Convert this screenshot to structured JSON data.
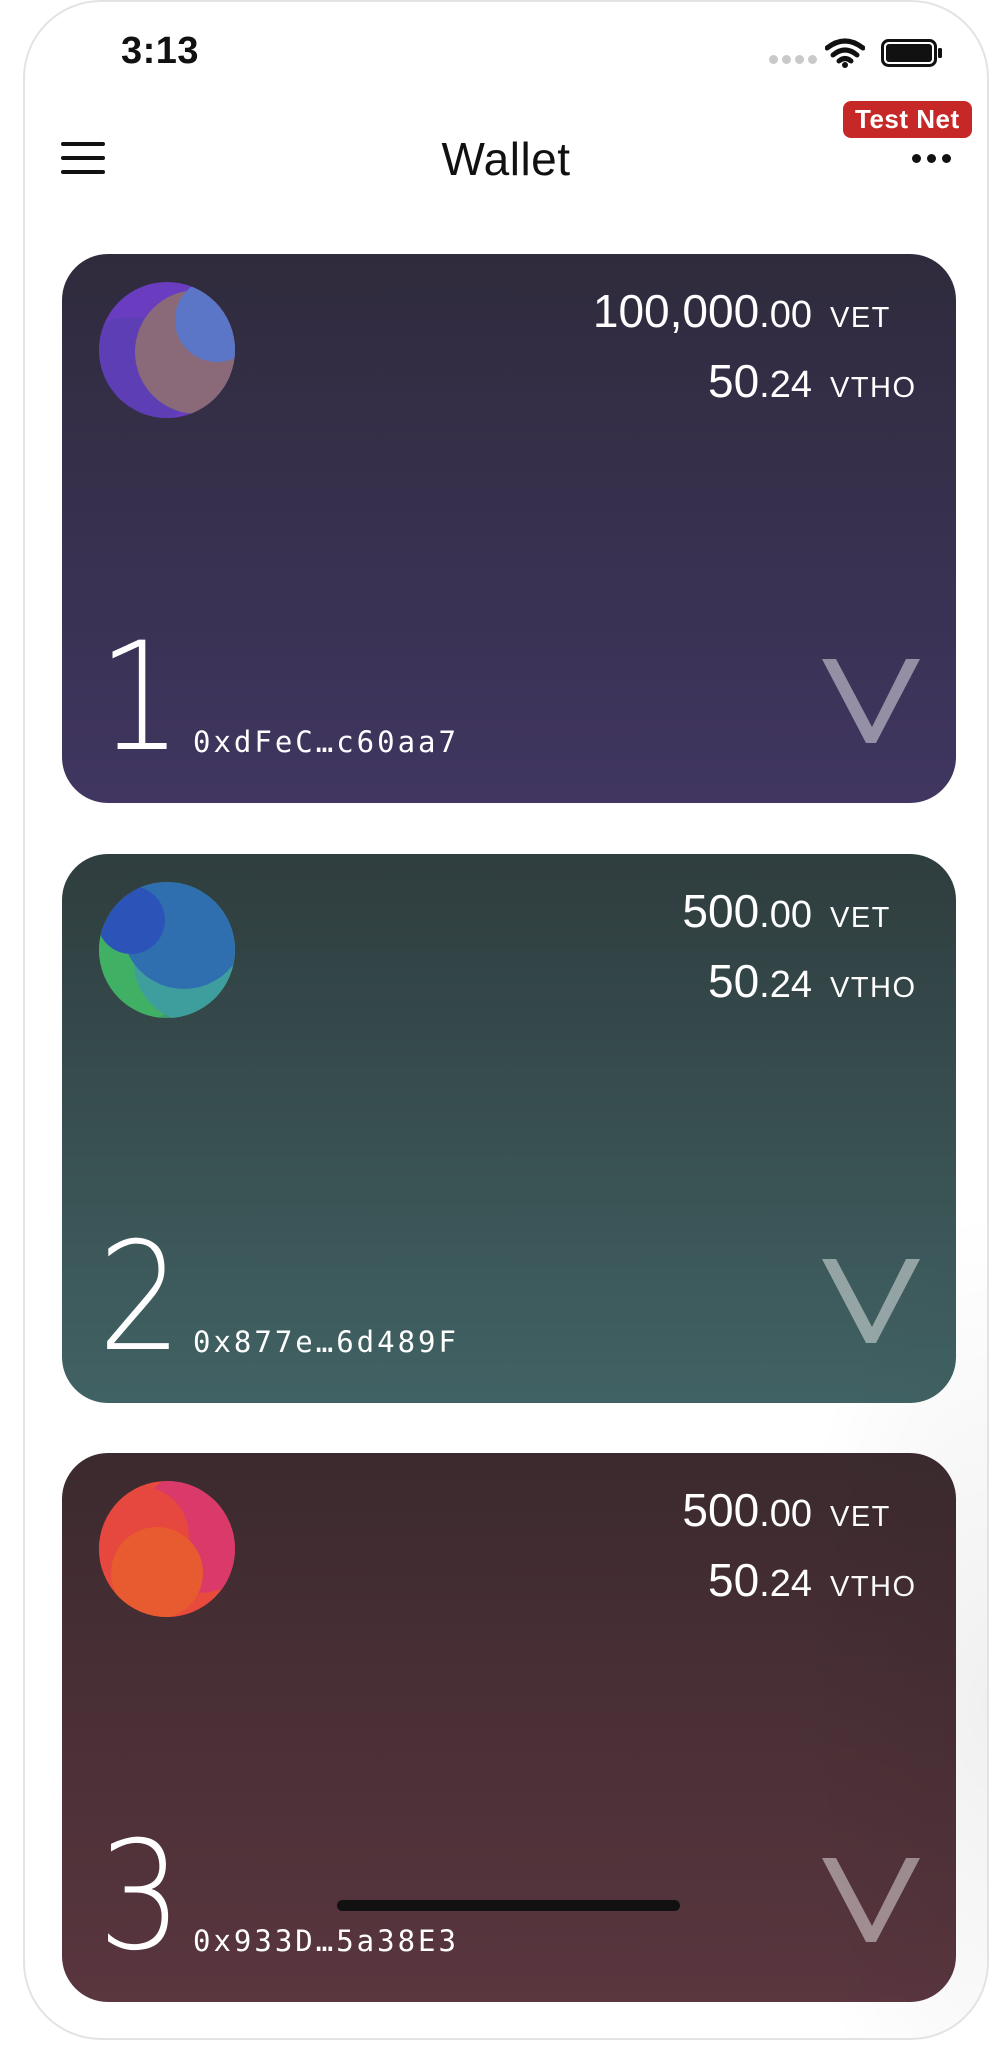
{
  "status_bar": {
    "time": "3:13"
  },
  "nav": {
    "title": "Wallet",
    "badge": "Test Net"
  },
  "wallets": [
    {
      "index": "1",
      "vet_int": "100,000",
      "vet_dec": ".00",
      "vet_unit": "VET",
      "vtho_int": "50",
      "vtho_dec": ".24",
      "vtho_unit": "VTHO",
      "address": "0xdFeC…c60aa7"
    },
    {
      "index": "2",
      "vet_int": "500",
      "vet_dec": ".00",
      "vet_unit": "VET",
      "vtho_int": "50",
      "vtho_dec": ".24",
      "vtho_unit": "VTHO",
      "address": "0x877e…6d489F"
    },
    {
      "index": "3",
      "vet_int": "500",
      "vet_dec": ".00",
      "vet_unit": "VET",
      "vtho_int": "50",
      "vtho_dec": ".24",
      "vtho_unit": "VTHO",
      "address": "0x933D…5a38E3"
    }
  ],
  "colors": {
    "badge": "#c62828",
    "card_1_top": "#2f2b3c",
    "card_1_bottom": "#403661",
    "card_2_top": "#2f3d3e",
    "card_2_bottom": "#416264",
    "card_3_top": "#3b2a2e",
    "card_3_bottom": "#5a363f"
  },
  "icons": {
    "menu": "hamburger-menu-icon",
    "more": "more-horizontal-icon",
    "wifi": "wifi-icon",
    "battery": "battery-icon",
    "vechain": "vechain-logo-icon"
  }
}
